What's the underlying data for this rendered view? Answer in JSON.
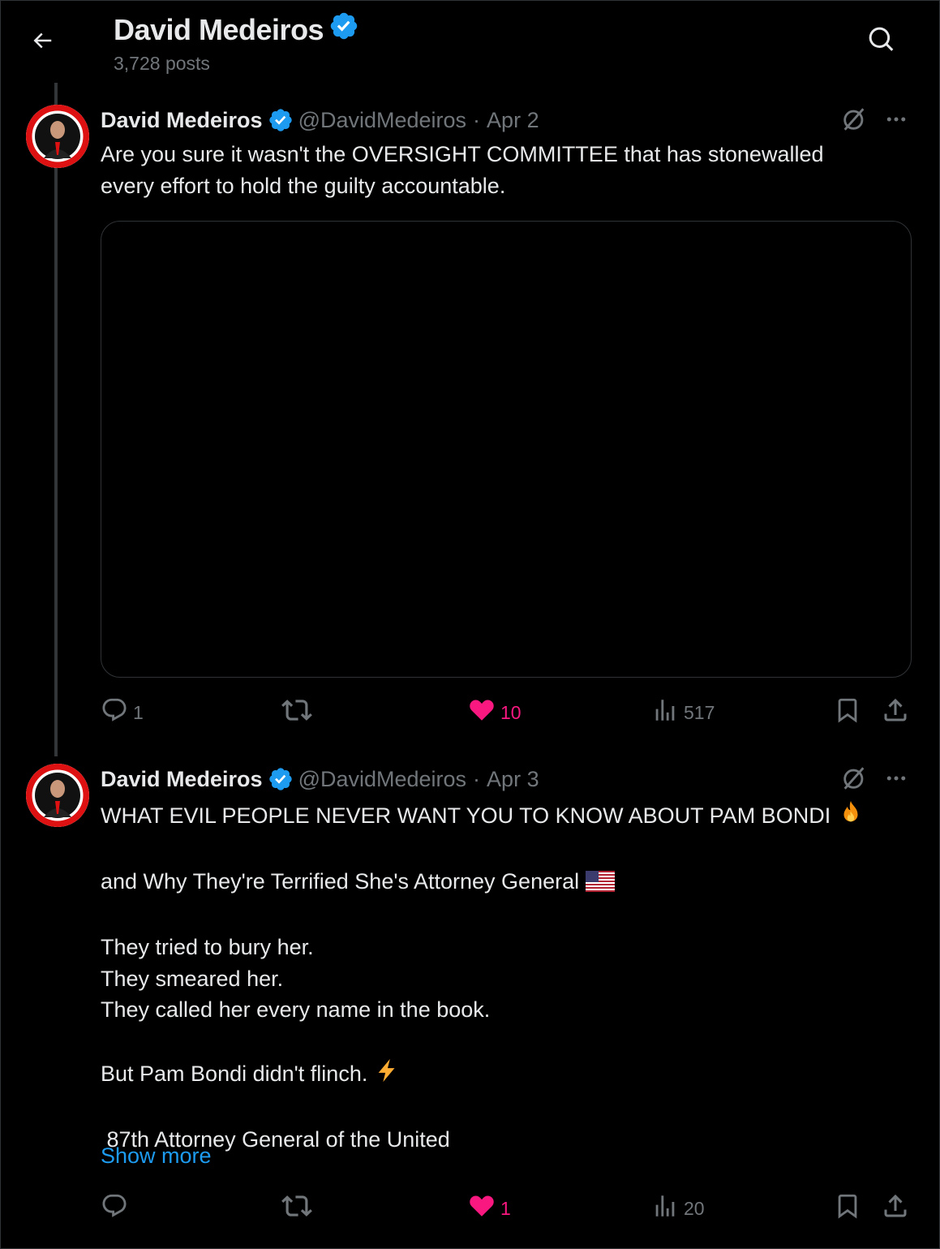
{
  "header": {
    "name": "David Medeiros",
    "posts_count": "3,728 posts"
  },
  "colors": {
    "background": "#000000",
    "verified": "#1d9bf0",
    "like": "#f91880",
    "muted": "#71767b",
    "link": "#1d9bf0"
  },
  "icons": [
    "back-arrow-icon",
    "search-icon",
    "verified-badge-icon",
    "grok-icon",
    "more-icon",
    "reply-icon",
    "retweet-icon",
    "heart-icon",
    "views-icon",
    "bookmark-icon",
    "share-icon",
    "fire-emoji",
    "us-flag-emoji",
    "lightning-emoji"
  ],
  "tweets": [
    {
      "author_name": "David Medeiros",
      "handle": "@DavidMedeiros",
      "sep": "·",
      "date": "Apr 2",
      "text_lines": [
        "Are you sure it wasn't the OVERSIGHT COMMITTEE that has stonewalled",
        "every effort to hold the guilty accountable."
      ],
      "has_media": true,
      "replies": "1",
      "retweets": "",
      "likes": "10",
      "liked": true,
      "views": "517"
    },
    {
      "author_name": "David Medeiros",
      "handle": "@DavidMedeiros",
      "sep": "·",
      "date": "Apr 3",
      "text_lines": [
        "WHAT EVIL PEOPLE NEVER WANT YOU TO KNOW ABOUT PAM BONDI",
        "",
        "and Why They're Terrified She's Attorney General",
        "",
        "They tried to bury her.",
        "They smeared her.",
        "They called her every name in the book.",
        "",
        "But Pam Bondi didn't flinch.",
        "",
        " 87th Attorney General of the United"
      ],
      "show_more": "Show more",
      "replies": "",
      "retweets": "",
      "likes": "1",
      "liked": true,
      "views": "20"
    }
  ]
}
